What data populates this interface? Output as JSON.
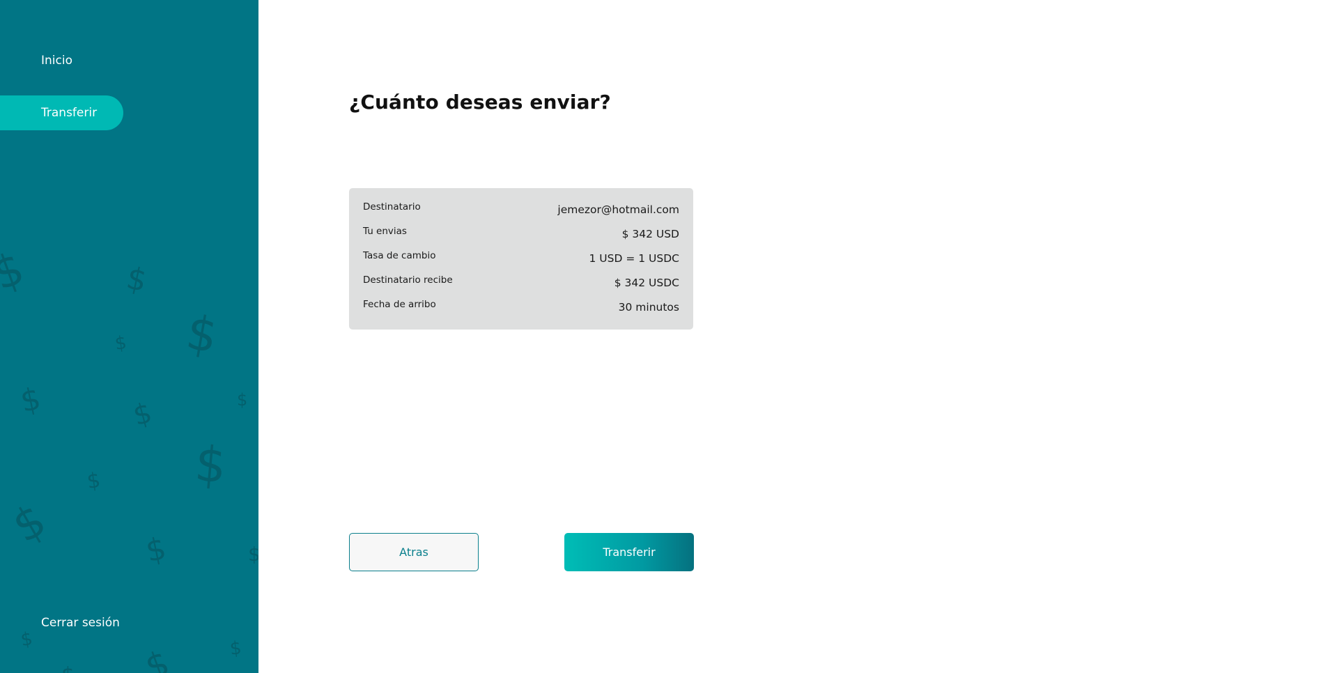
{
  "sidebar": {
    "items": [
      {
        "label": "Inicio",
        "active": false
      },
      {
        "label": "Transferir",
        "active": true
      }
    ],
    "logout_label": "Cerrar sesión",
    "background_color": "#017585",
    "active_color": "#00b9b4",
    "decoration_icon": "dollar-sign-icon"
  },
  "main": {
    "title": "¿Cuánto deseas enviar?",
    "summary": {
      "rows": [
        {
          "label": "Destinatario",
          "value": "jemezor@hotmail.com"
        },
        {
          "label": "Tu envias",
          "value": "$ 342 USD"
        },
        {
          "label": "Tasa de cambio",
          "value": "1 USD = 1 USDC"
        },
        {
          "label": "Destinatario recibe",
          "value": "$ 342 USDC"
        },
        {
          "label": "Fecha de arribo",
          "value": "30 minutos"
        }
      ]
    },
    "buttons": {
      "back_label": "Atras",
      "transfer_label": "Transferir"
    }
  }
}
